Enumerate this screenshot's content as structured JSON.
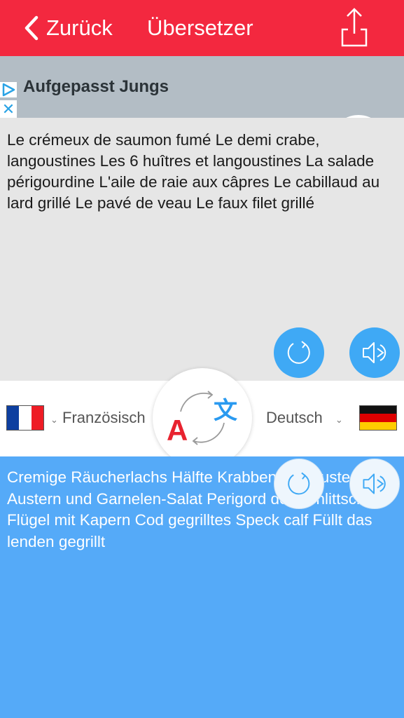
{
  "navbar": {
    "back_label": "Zurück",
    "title": "Übersetzer",
    "share_icon": "share-icon",
    "color": "#f3283f"
  },
  "ad": {
    "title": "Aufgepasst Jungs",
    "close_glyph": "✕",
    "arrow_icon": "arrow-right-icon"
  },
  "source": {
    "text": "Le crémeux de saumon fumé Le demi crabe, langoustines Les 6 huîtres et langoustines La salade périgourdine L'aile de raie aux câpres Le cabillaud au lard grillé Le pavé de veau Le faux filet grillé",
    "language": "Französisch",
    "flag": "france-flag"
  },
  "target": {
    "text": "Cremige Räucherlachs Hälfte Krabben, Langusten 6 Austern und Garnelen-Salat Perigord der Schlittschuh Flügel mit Kapern Cod gegrilltes Speck calf Füllt das lenden gegrillt",
    "language": "Deutsch",
    "flag": "germany-flag"
  },
  "swap": {
    "letter_a": "A",
    "letter_translate": "文"
  },
  "colors": {
    "accent_red": "#f3283f",
    "source_bg": "#e6e6e6",
    "target_bg": "#55aaf8",
    "button_blue": "#3fa9f5"
  }
}
